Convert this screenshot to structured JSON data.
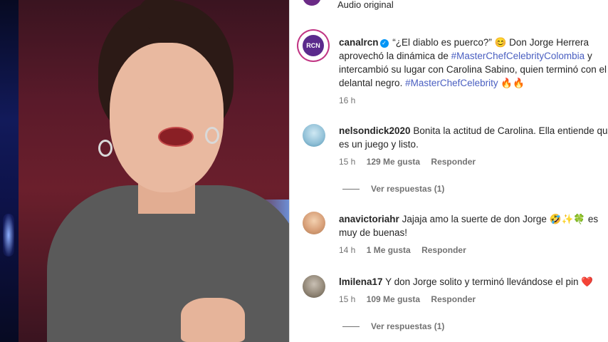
{
  "video": {},
  "audio": {
    "label": "Audio original"
  },
  "caption": {
    "username": "canalrcn",
    "avatar_text": "RCN",
    "line1_text": "“¿El diablo es puerco?” 😊 Don Jorge Herrera",
    "line2_pre": "aprovechó la dinámica de ",
    "line2_tag": "#MasterChefCelebrityColombia",
    "line2_post": " y",
    "line3_text": "intercambió su lugar con Carolina Sabino, quien terminó con el",
    "line4_pre": "delantal negro. ",
    "line4_tag": "#MasterChefCelebrity",
    "line4_post": " 🔥🔥",
    "time": "16 h"
  },
  "comments": [
    {
      "username": "nelsondick2020",
      "line1": "Bonita la actitud de Carolina. Ella entiende que",
      "line2": "es un juego y listo.",
      "time": "15 h",
      "likes": "129 Me gusta",
      "reply": "Responder",
      "view_replies": "Ver respuestas (1)"
    },
    {
      "username": "anavictoriahr",
      "line1": "Jajaja amo la suerte de don Jorge 🤣✨🍀 es",
      "line2": "muy de buenas!",
      "time": "14 h",
      "likes": "1 Me gusta",
      "reply": "Responder"
    },
    {
      "username": "lmilena17",
      "line1": "Y don Jorge solito y terminó llevándose el pin ❤️",
      "time": "15 h",
      "likes": "109 Me gusta",
      "reply": "Responder",
      "view_replies": "Ver respuestas (1)"
    }
  ],
  "colors": {
    "hashtag": "#4a5fc1",
    "verified": "#0095f6",
    "meta_gray": "#737373",
    "avatar_ring": "#c13584"
  }
}
